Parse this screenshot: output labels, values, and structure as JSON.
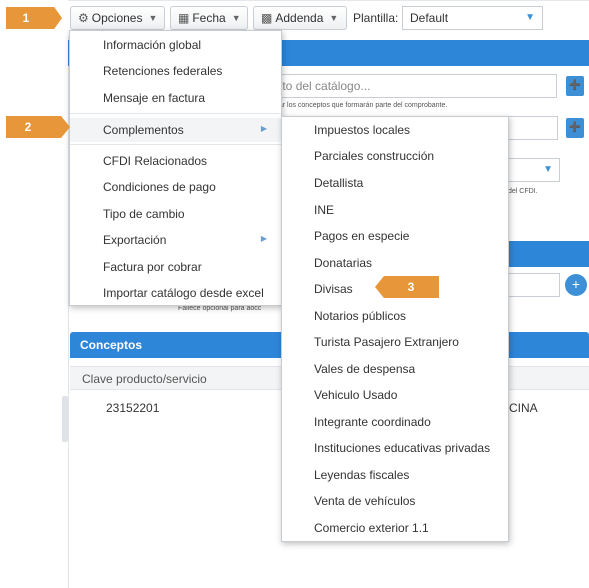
{
  "toolbar": {
    "opciones_label": "Opciones",
    "fecha_label": "Fecha",
    "addenda_label": "Addenda",
    "plantilla_label": "Plantilla:",
    "plantilla_value": "Default"
  },
  "background": {
    "concept_search_placeholder": "epto del catálogo...",
    "concept_hint": "cionar los conceptos que formarán parte del comprobante.",
    "cfdi_hint": "del CFDI.",
    "partial_hint": "Fallece opcional para aocc",
    "conceptos_title": "Conceptos",
    "column_clave": "Clave producto/servicio",
    "row_clave": "23152201",
    "row_desc_fragment": "CINA"
  },
  "menu_opciones": {
    "items": [
      "Información global",
      "Retenciones federales",
      "Mensaje en factura",
      "Complementos",
      "CFDI Relacionados",
      "Condiciones de pago",
      "Tipo de cambio",
      "Exportación",
      "Factura por cobrar",
      "Importar catálogo desde excel"
    ]
  },
  "menu_complementos": {
    "items": [
      "Impuestos locales",
      "Parciales construcción",
      "Detallista",
      "INE",
      "Pagos en especie",
      "Donatarias",
      "Divisas",
      "Notarios públicos",
      "Turista Pasajero Extranjero",
      "Vales de despensa",
      "Vehiculo Usado",
      "Integrante coordinado",
      "Instituciones educativas privadas",
      "Leyendas fiscales",
      "Venta de vehículos",
      "Comercio exterior 1.1"
    ]
  },
  "callouts": {
    "one": "1",
    "two": "2",
    "three": "3"
  },
  "icons": {
    "gear": "gear-icon",
    "calendar": "calendar-icon",
    "calculator": "calculator-icon"
  },
  "colors": {
    "accent": "#2e86d9",
    "callout": "#e8963a"
  }
}
